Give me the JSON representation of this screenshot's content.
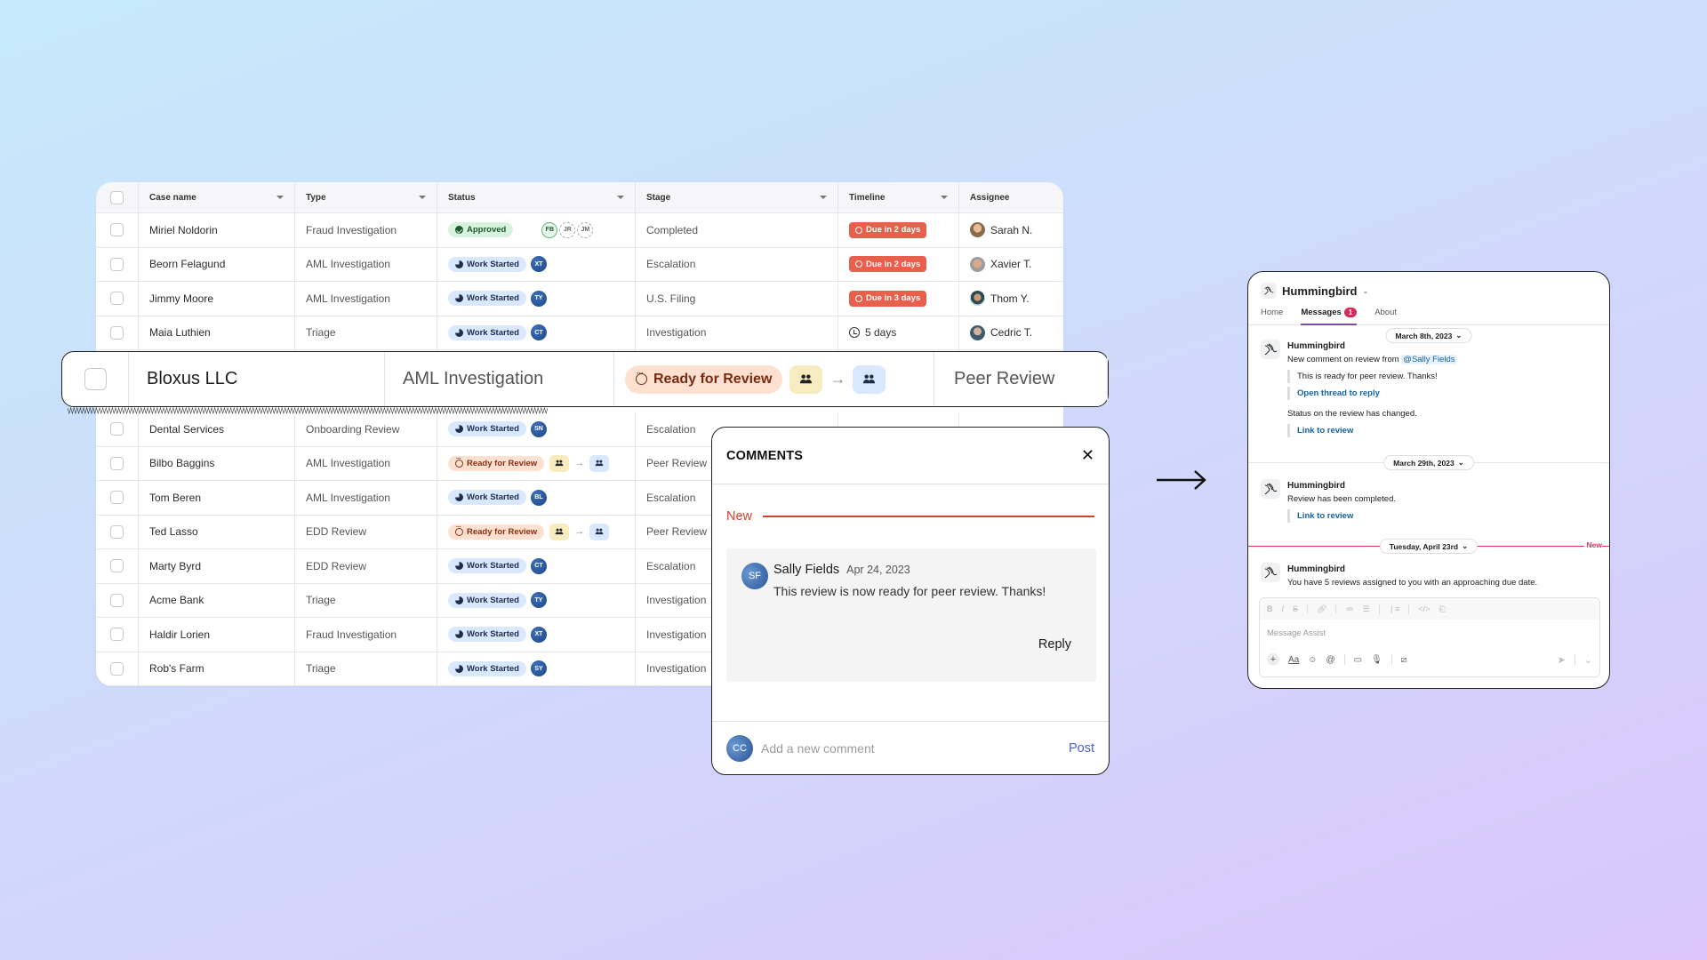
{
  "table": {
    "columns": [
      "Case name",
      "Type",
      "Status",
      "Stage",
      "Timeline",
      "Assignee"
    ],
    "rows_top": [
      {
        "name": "Miriel Noldorin",
        "type": "Fraud Investigation",
        "status": "Approved",
        "status_kind": "approved",
        "initials": [
          "FB",
          "JR",
          "JM"
        ],
        "stage": "Completed",
        "timeline": "Due in 2 days",
        "timeline_kind": "due",
        "assignee": "Sarah N."
      },
      {
        "name": "Beorn Felagund",
        "type": "AML Investigation",
        "status": "Work Started",
        "status_kind": "work",
        "initials": [
          "XT"
        ],
        "stage": "Escalation",
        "timeline": "Due in 2 days",
        "timeline_kind": "due",
        "assignee": "Xavier T."
      },
      {
        "name": "Jimmy Moore",
        "type": "AML Investigation",
        "status": "Work Started",
        "status_kind": "work",
        "initials": [
          "TY"
        ],
        "stage": "U.S. Filing",
        "timeline": "Due in 3 days",
        "timeline_kind": "due",
        "assignee": "Thom Y."
      },
      {
        "name": "Maia Luthien",
        "type": "Triage",
        "status": "Work Started",
        "status_kind": "work",
        "initials": [
          "CT"
        ],
        "stage": "Investigation",
        "timeline": "5 days",
        "timeline_kind": "plain",
        "assignee": "Cedric T."
      }
    ],
    "rows_bottom": [
      {
        "name": "Dental Services",
        "type": "Onboarding Review",
        "status": "Work Started",
        "status_kind": "work",
        "initials": [
          "SN"
        ],
        "stage": "Escalation"
      },
      {
        "name": "Bilbo Baggins",
        "type": "AML Investigation",
        "status": "Ready for Review",
        "status_kind": "ready",
        "stage": "Peer Review"
      },
      {
        "name": "Tom Beren",
        "type": "AML Investigation",
        "status": "Work Started",
        "status_kind": "work",
        "initials": [
          "BL"
        ],
        "stage": "Escalation"
      },
      {
        "name": "Ted Lasso",
        "type": "EDD Review",
        "status": "Ready for Review",
        "status_kind": "ready",
        "stage": "Peer Review"
      },
      {
        "name": "Marty Byrd",
        "type": "EDD Review",
        "status": "Work Started",
        "status_kind": "work",
        "initials": [
          "CT"
        ],
        "stage": "Escalation"
      },
      {
        "name": "Acme Bank",
        "type": "Triage",
        "status": "Work Started",
        "status_kind": "work",
        "initials": [
          "TY"
        ],
        "stage": "Investigation"
      },
      {
        "name": "Haldir Lorien",
        "type": "Fraud Investigation",
        "status": "Work Started",
        "status_kind": "work",
        "initials": [
          "XT"
        ],
        "stage": "Investigation"
      },
      {
        "name": "Rob's Farm",
        "type": "Triage",
        "status": "Work Started",
        "status_kind": "work",
        "initials": [
          "SY"
        ],
        "stage": "Investigation"
      }
    ]
  },
  "highlight_row": {
    "name": "Bloxus LLC",
    "type": "AML Investigation",
    "status": "Ready for Review",
    "stage": "Peer Review"
  },
  "comments": {
    "title": "COMMENTS",
    "new_label": "New",
    "comment": {
      "avatar_initials": "SF",
      "author": "Sally Fields",
      "date": "Apr 24, 2023",
      "text": "This review is now ready for peer review. Thanks!",
      "reply_label": "Reply"
    },
    "composer": {
      "avatar_initials": "CC",
      "placeholder": "Add a new comment",
      "post_label": "Post"
    }
  },
  "slack": {
    "app_name": "Hummingbird",
    "tabs": [
      {
        "label": "Home"
      },
      {
        "label": "Messages",
        "badge": "1",
        "active": true
      },
      {
        "label": "About"
      }
    ],
    "sections": [
      {
        "date": "March 8th, 2023",
        "sender": "Hummingbird",
        "line1_prefix": "New comment on review from",
        "mention": "@Sally Fields",
        "quote": "This is ready for peer review. Thanks!",
        "link1": "Open thread to reply",
        "line2": "Status on the review has changed.",
        "link2": "Link to review"
      },
      {
        "date": "March 29th, 2023",
        "sender": "Hummingbird",
        "text": "Review has been completed.",
        "link": "Link to review"
      },
      {
        "date": "Tuesday, April 23rd",
        "new_label": "New",
        "sender": "Hummingbird",
        "text": "You have 5 reviews assigned to you with an approaching due date."
      }
    ],
    "composer": {
      "placeholder": "Message Assist",
      "format_buttons": [
        "B",
        "I",
        "S",
        "link",
        "ordered-list",
        "bulleted-list",
        "blockquote",
        "code",
        "code-block"
      ]
    }
  },
  "colors": {
    "due_red": "#e8604c",
    "new_red": "#d2412b",
    "post_blue": "#4a62d6",
    "slack_badge": "#d5285b",
    "slack_link": "#1264a3"
  }
}
